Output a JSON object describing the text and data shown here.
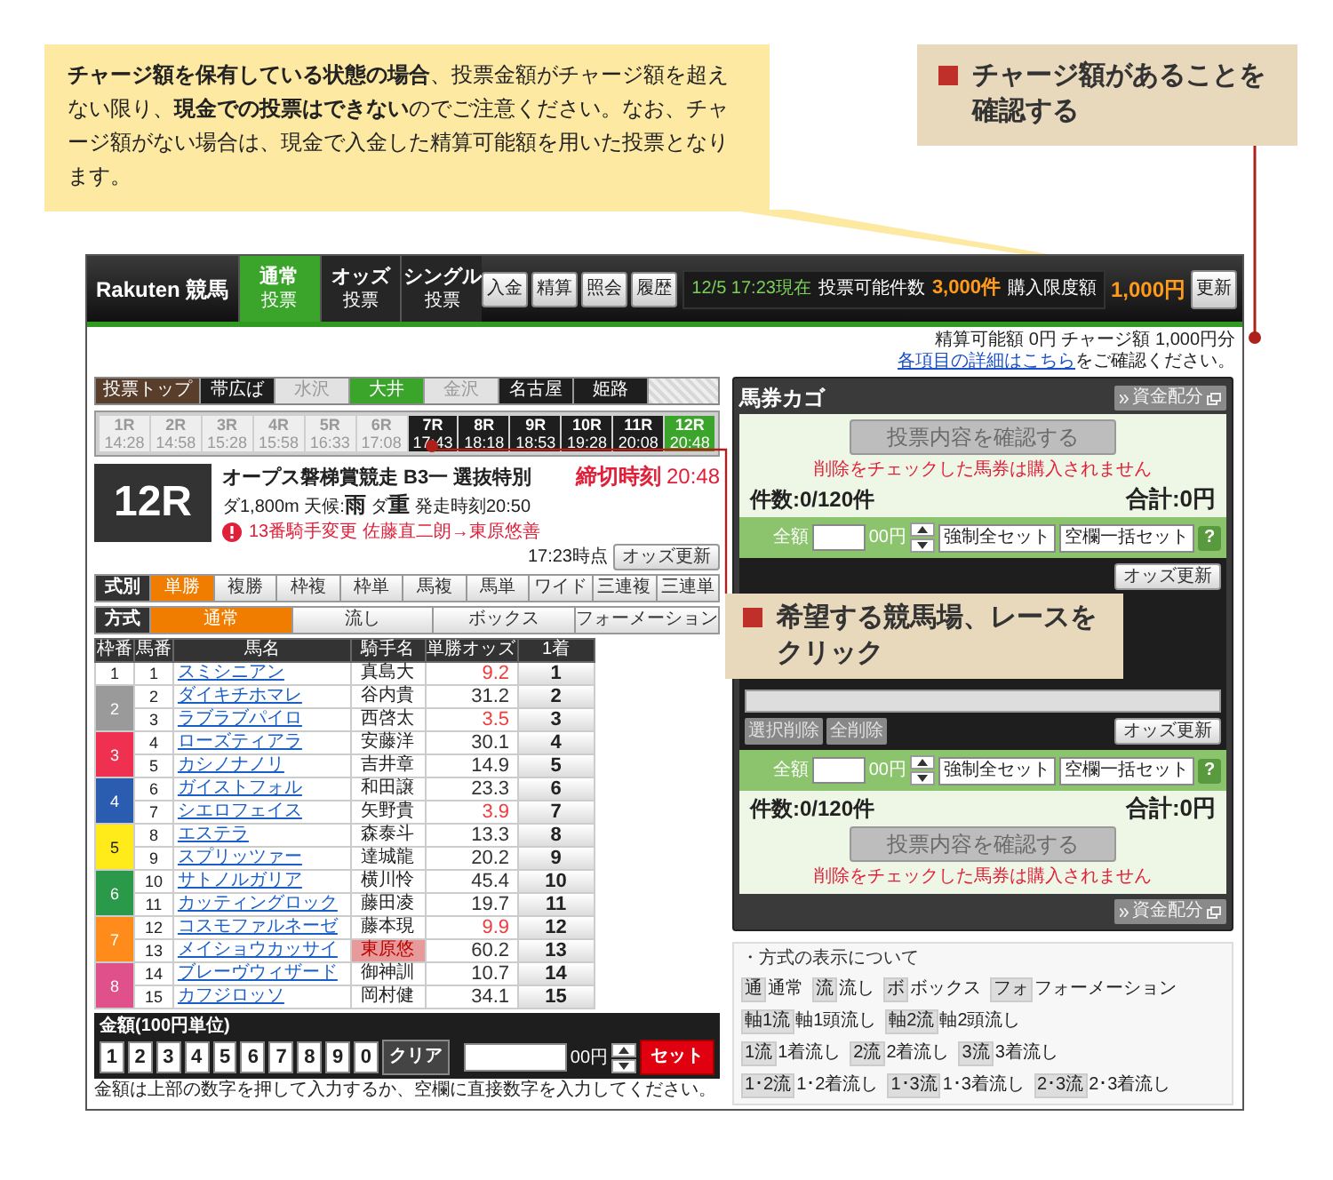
{
  "note": {
    "text": "**チャージ額を保有している状態の場合**、投票金額がチャージ額を超えない限り、**現金での投票はできない**のでご注意ください。なお、チャージ額がない場合は、現金で入金した精算可能額を用いた投票となります。"
  },
  "callout_charge": {
    "text": "チャージ額があることを確認する"
  },
  "callout_race": {
    "text": "希望する競馬場、レースをクリック"
  },
  "header": {
    "logo": "Rakuten 競馬",
    "tabs": [
      {
        "label": "通常",
        "sub": "投票",
        "selected": true
      },
      {
        "label": "オッズ",
        "sub": "投票",
        "selected": false
      },
      {
        "label": "シングル",
        "sub": "投票",
        "selected": false
      }
    ],
    "buttons": [
      "入金",
      "精算",
      "照会",
      "履歴"
    ],
    "datetime": "12/5 17:23現在",
    "count_label": "投票可能件数",
    "count": "3,000件",
    "limit_label": "購入限度額",
    "limit": "1,000円",
    "refresh": "更新"
  },
  "balance": {
    "text": "精算可能額 0円 チャージ額 1,000円分",
    "link": "各項目の詳細はこちら",
    "suffix": "をご確認ください。"
  },
  "venues": {
    "top_button": "投票トップ",
    "items": [
      {
        "label": "帯広ば",
        "selected": false,
        "disabled": false
      },
      {
        "label": "水沢",
        "selected": false,
        "disabled": true
      },
      {
        "label": "大井",
        "selected": true,
        "disabled": false
      },
      {
        "label": "金沢",
        "selected": false,
        "disabled": true
      },
      {
        "label": "名古屋",
        "selected": false,
        "disabled": false
      },
      {
        "label": "姫路",
        "selected": false,
        "disabled": false
      }
    ]
  },
  "races": [
    {
      "label": "1R",
      "time": "14:28",
      "selected": false,
      "disabled": true
    },
    {
      "label": "2R",
      "time": "14:58",
      "selected": false,
      "disabled": true
    },
    {
      "label": "3R",
      "time": "15:28",
      "selected": false,
      "disabled": true
    },
    {
      "label": "4R",
      "time": "15:58",
      "selected": false,
      "disabled": true
    },
    {
      "label": "5R",
      "time": "16:33",
      "selected": false,
      "disabled": true
    },
    {
      "label": "6R",
      "time": "17:08",
      "selected": false,
      "disabled": true
    },
    {
      "label": "7R",
      "time": "17:43",
      "selected": false,
      "disabled": false
    },
    {
      "label": "8R",
      "time": "18:18",
      "selected": false,
      "disabled": false
    },
    {
      "label": "9R",
      "time": "18:53",
      "selected": false,
      "disabled": false
    },
    {
      "label": "10R",
      "time": "19:28",
      "selected": false,
      "disabled": false
    },
    {
      "label": "11R",
      "time": "20:08",
      "selected": false,
      "disabled": false
    },
    {
      "label": "12R",
      "time": "20:48",
      "selected": true,
      "disabled": false
    }
  ],
  "race": {
    "number": "12R",
    "title": "オープス磐梯賞競走 B3一 選抜特別",
    "details": "ダ1,800m 天候:**雨** ダ**重** 発走時刻20:50",
    "notice": "13番騎手変更 佐藤直二朗→東原悠善",
    "deadline_label": "締切時刻",
    "deadline": "20:48",
    "odds_time": "17:23時点",
    "odds_button": "オッズ更新"
  },
  "bet_types": {
    "label": "式別",
    "items": [
      {
        "label": "単勝",
        "selected": true
      },
      {
        "label": "複勝",
        "selected": false
      },
      {
        "label": "枠複",
        "selected": false
      },
      {
        "label": "枠単",
        "selected": false
      },
      {
        "label": "馬複",
        "selected": false
      },
      {
        "label": "馬単",
        "selected": false
      },
      {
        "label": "ワイド",
        "selected": false
      },
      {
        "label": "三連複",
        "selected": false
      },
      {
        "label": "三連単",
        "selected": false
      }
    ]
  },
  "methods": {
    "label": "方式",
    "items": [
      {
        "label": "通常",
        "selected": true
      },
      {
        "label": "流し",
        "selected": false
      },
      {
        "label": "ボックス",
        "selected": false
      },
      {
        "label": "フォーメーション",
        "selected": false
      }
    ]
  },
  "table": {
    "columns": [
      "枠番",
      "馬番",
      "馬名",
      "騎手名",
      "単勝オッズ",
      "1着"
    ],
    "frames": [
      {
        "number": "1",
        "color": "#ffffff",
        "horses": [
          {
            "number": "1",
            "name": "スミシニアン",
            "jockey": "真島大",
            "odds": "9.2",
            "favored": true,
            "jockey_changed": false,
            "pick": "1"
          }
        ]
      },
      {
        "number": "2",
        "color": "#9a9a9a",
        "horses": [
          {
            "number": "2",
            "name": "ダイキチホマレ",
            "jockey": "谷内貴",
            "odds": "31.2",
            "favored": false,
            "jockey_changed": false,
            "pick": "2"
          },
          {
            "number": "3",
            "name": "ラブラブパイロ",
            "jockey": "西啓太",
            "odds": "3.5",
            "favored": true,
            "jockey_changed": false,
            "pick": "3"
          }
        ]
      },
      {
        "number": "3",
        "color": "#f03050",
        "horses": [
          {
            "number": "4",
            "name": "ローズティアラ",
            "jockey": "安藤洋",
            "odds": "30.1",
            "favored": false,
            "jockey_changed": false,
            "pick": "4"
          },
          {
            "number": "5",
            "name": "カシノナノリ",
            "jockey": "吉井章",
            "odds": "14.9",
            "favored": false,
            "jockey_changed": false,
            "pick": "5"
          }
        ]
      },
      {
        "number": "4",
        "color": "#2a5db0",
        "horses": [
          {
            "number": "6",
            "name": "ガイストフォル",
            "jockey": "和田譲",
            "odds": "23.3",
            "favored": false,
            "jockey_changed": false,
            "pick": "6"
          },
          {
            "number": "7",
            "name": "シエロフェイス",
            "jockey": "矢野貴",
            "odds": "3.9",
            "favored": true,
            "jockey_changed": false,
            "pick": "7"
          }
        ]
      },
      {
        "number": "5",
        "color": "#ffeb1a",
        "horses": [
          {
            "number": "8",
            "name": "エステラ",
            "jockey": "森泰斗",
            "odds": "13.3",
            "favored": false,
            "jockey_changed": false,
            "pick": "8"
          },
          {
            "number": "9",
            "name": "スプリッツァー",
            "jockey": "達城龍",
            "odds": "20.2",
            "favored": false,
            "jockey_changed": false,
            "pick": "9"
          }
        ]
      },
      {
        "number": "6",
        "color": "#2a9a4a",
        "horses": [
          {
            "number": "10",
            "name": "サトノルガリア",
            "jockey": "横川怜",
            "odds": "45.4",
            "favored": false,
            "jockey_changed": false,
            "pick": "10"
          },
          {
            "number": "11",
            "name": "カッティングロック",
            "jockey": "藤田凌",
            "odds": "19.7",
            "favored": false,
            "jockey_changed": false,
            "pick": "11"
          }
        ]
      },
      {
        "number": "7",
        "color": "#ff8c1a",
        "horses": [
          {
            "number": "12",
            "name": "コスモファルネーゼ",
            "jockey": "藤本現",
            "odds": "9.9",
            "favored": true,
            "jockey_changed": false,
            "pick": "12"
          },
          {
            "number": "13",
            "name": "メイショウカッサイ",
            "jockey": "東原悠",
            "odds": "60.2",
            "favored": false,
            "jockey_changed": true,
            "pick": "13"
          }
        ]
      },
      {
        "number": "8",
        "color": "#e0508a",
        "horses": [
          {
            "number": "14",
            "name": "ブレーヴウィザード",
            "jockey": "御神訓",
            "odds": "10.7",
            "favored": false,
            "jockey_changed": false,
            "pick": "14"
          },
          {
            "number": "15",
            "name": "カフジロッソ",
            "jockey": "岡村健",
            "odds": "34.1",
            "favored": false,
            "jockey_changed": false,
            "pick": "15"
          }
        ]
      }
    ]
  },
  "amount_pad": {
    "label": "金額(100円単位)",
    "keys": [
      "1",
      "2",
      "3",
      "4",
      "5",
      "6",
      "7",
      "8",
      "9",
      "0"
    ],
    "clear": "クリア",
    "suffix": "00円",
    "set": "セット"
  },
  "footer_note": "金額は上部の数字を押して入力するか、空欄に直接数字を入力してください。",
  "basket": {
    "title": "馬券カゴ",
    "distribute": [
      "資金配分",
      "資金配分"
    ],
    "sections": [
      {
        "kind": "summary",
        "confirm": "投票内容を確認する",
        "confirm_disabled": true,
        "note": "削除をチェックした馬券は購入されません",
        "count": "件数:0/120件",
        "total": "合計:0円"
      },
      {
        "kind": "amount",
        "label": "全額",
        "suffix": "00円",
        "force_set": "強制全セット",
        "bulk_set": "空欄一括セット",
        "help": "?"
      },
      {
        "kind": "list",
        "odds_refresh_top": "オッズ更新",
        "delete_selected": "選択削除",
        "delete_all": "全削除",
        "odds_refresh": "オッズ更新"
      },
      {
        "kind": "amount",
        "label": "全額",
        "suffix": "00円",
        "force_set": "強制全セット",
        "bulk_set": "空欄一括セット",
        "help": "?"
      },
      {
        "kind": "summary_reverse",
        "confirm": "投票内容を確認する",
        "confirm_disabled": true,
        "note": "削除をチェックした馬券は購入されません",
        "count": "件数:0/120件",
        "total": "合計:0円"
      }
    ]
  },
  "legend": {
    "title": "・方式の表示について",
    "rows": [
      [
        {
          "badge": "通",
          "label": "通常"
        },
        {
          "badge": "流",
          "label": "流し"
        },
        {
          "badge": "ボ",
          "label": "ボックス"
        },
        {
          "badge": "フォ",
          "label": "フォーメーション"
        }
      ],
      [
        {
          "badge": "軸1流",
          "label": "軸1頭流し"
        },
        {
          "badge": "軸2流",
          "label": "軸2頭流し"
        }
      ],
      [
        {
          "badge": "1流",
          "label": "1着流し"
        },
        {
          "badge": "2流",
          "label": "2着流し"
        },
        {
          "badge": "3流",
          "label": "3着流し"
        }
      ],
      [
        {
          "badge": "1･2流",
          "label": "1･2着流し"
        },
        {
          "badge": "1･3流",
          "label": "1･3着流し"
        },
        {
          "badge": "2･3流",
          "label": "2･3着流し"
        }
      ]
    ]
  }
}
